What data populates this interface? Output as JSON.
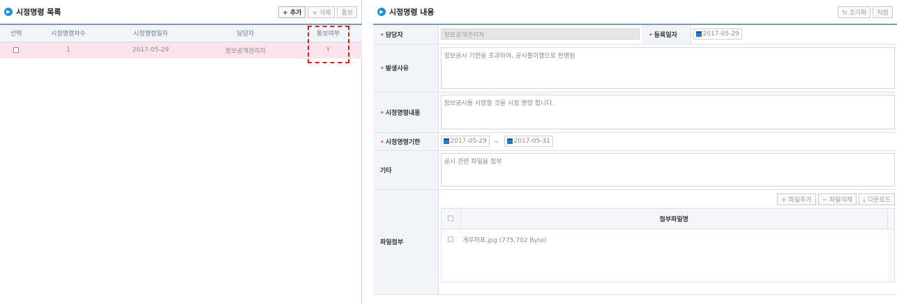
{
  "left": {
    "title": "시정명령 목록",
    "buttons": {
      "add": "+ 추가",
      "delete": "× 삭제",
      "notify": "통보"
    },
    "columns": [
      "선택",
      "시정명령차수",
      "시정명령일자",
      "담당자",
      "통보여부"
    ],
    "rows": [
      {
        "order": "1",
        "date": "2017-05-29",
        "manager": "정보공개관리자",
        "notified": "Y"
      }
    ]
  },
  "right": {
    "title": "시정명령 내용",
    "buttons": {
      "reset": "↻ 초기화",
      "save": "저장"
    },
    "labels": {
      "manager": "담당자",
      "reg_date": "등록일자",
      "reason": "발생사유",
      "content": "시정명령내용",
      "period": "시정명령기한",
      "etc": "기타",
      "attach": "파일첨부"
    },
    "values": {
      "manager": "정보공개관리자",
      "reg_date": "2017-05-29",
      "reason": "정보공시 기한을 초과하여, 공시불이행으로 판명됨",
      "content": "정보공시를 시행할 것을 시정 명령 합니다.",
      "period_start": "2017-05-29",
      "period_sep": "~",
      "period_end": "2017-05-31",
      "etc": "공시 관련 파일을 첨부"
    },
    "file_buttons": {
      "add": "+ 파일추가",
      "delete": "− 파일삭제",
      "download": "⤓ 다운로드"
    },
    "file_column": "첨부파일명",
    "files": [
      {
        "name": "게무저표.jpg (775,702 Byte)"
      }
    ]
  }
}
